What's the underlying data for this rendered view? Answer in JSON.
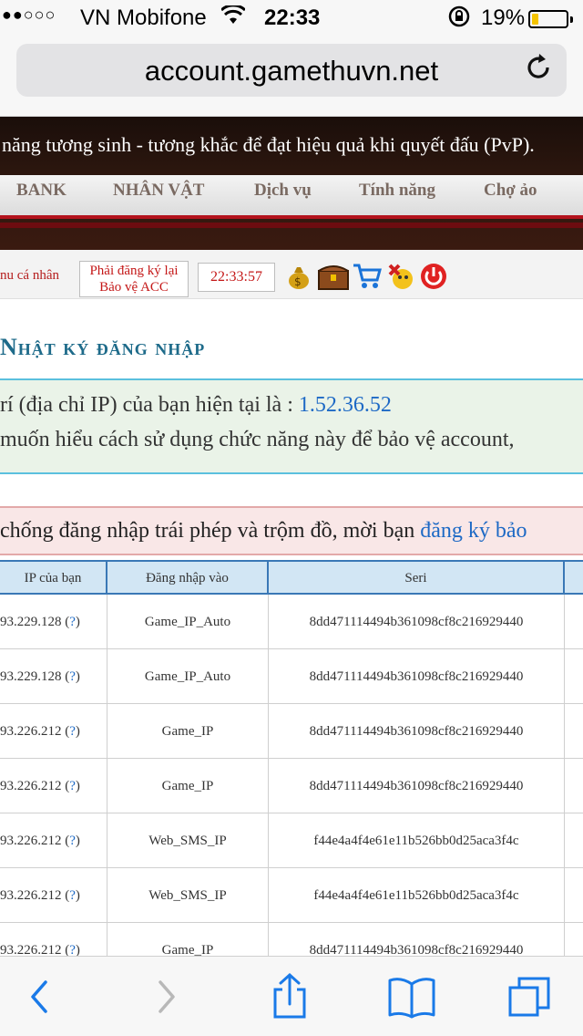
{
  "status": {
    "carrier": "VN Mobifone",
    "signal_dots": "●●○○○",
    "time": "22:33",
    "battery_percent": "19%",
    "battery_level": 0.19,
    "battery_color": "#f5c400"
  },
  "browser": {
    "url": "account.gamethuvn.net",
    "reload_icon": "reload-icon"
  },
  "banner": {
    "marquee": "năng tương sinh - tương khắc để đạt hiệu quả khi quyết đấu (PvP).",
    "nav": [
      "BANK",
      "NHÂN VẬT",
      "Dịch vụ",
      "Tính năng",
      "Chợ ảo"
    ]
  },
  "toolbar": {
    "menu_label": "nu cá nhân",
    "warning_line1": "Phải đăng ký lại",
    "warning_line2": "Bảo vệ ACC",
    "clock": "22:33:57",
    "icons": [
      "money-bag-icon",
      "treasure-chest-icon",
      "cart-icon",
      "gift-icon",
      "power-icon"
    ]
  },
  "page": {
    "heading": "Nhật ký đăng nhập",
    "info_prefix": "rí (địa chỉ IP) của bạn hiện tại là : ",
    "current_ip": "1.52.36.52",
    "info_line2": " muốn hiểu cách sử dụng chức năng này để bảo vệ account,",
    "warn_text": "chống đăng nhập trái phép và trộm đồ, mời bạn ",
    "warn_link": "đăng ký bảo"
  },
  "table": {
    "headers": [
      "IP của bạn",
      "Đăng nhập vào",
      "Seri",
      ""
    ],
    "rows": [
      {
        "ip": "93.229.128",
        "q": "?",
        "login": "Game_IP_Auto",
        "seri": "8dd471114494b361098cf8c216929440"
      },
      {
        "ip": "93.229.128",
        "q": "?",
        "login": "Game_IP_Auto",
        "seri": "8dd471114494b361098cf8c216929440"
      },
      {
        "ip": "93.226.212",
        "q": "?",
        "login": "Game_IP",
        "seri": "8dd471114494b361098cf8c216929440"
      },
      {
        "ip": "93.226.212",
        "q": "?",
        "login": "Game_IP",
        "seri": "8dd471114494b361098cf8c216929440"
      },
      {
        "ip": "93.226.212",
        "q": "?",
        "login": "Web_SMS_IP",
        "seri": "f44e4a4f4e61e11b526bb0d25aca3f4c"
      },
      {
        "ip": "93.226.212",
        "q": "?",
        "login": "Web_SMS_IP",
        "seri": "f44e4a4f4e61e11b526bb0d25aca3f4c"
      },
      {
        "ip": "93.226.212",
        "q": "?",
        "login": "Game_IP",
        "seri": "8dd471114494b361098cf8c216929440"
      }
    ]
  },
  "bottom_toolbar": {
    "icons": [
      "back-icon",
      "forward-icon",
      "share-icon",
      "bookmarks-icon",
      "tabs-icon"
    ],
    "accent": "#1a7ae8"
  }
}
